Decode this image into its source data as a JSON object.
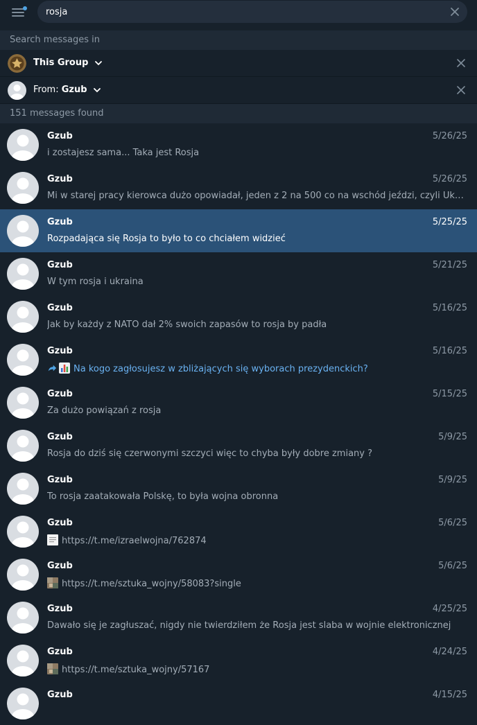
{
  "search": {
    "query": "rosja",
    "section_label": "Search messages in"
  },
  "filters": {
    "chat": {
      "label": "This Group"
    },
    "from": {
      "prefix": "From: ",
      "value": "Gzub"
    }
  },
  "results_count": "151 messages found",
  "results": [
    {
      "name": "Gzub",
      "date": "5/26/25",
      "text": "i zostajesz sama... Taka jest Rosja"
    },
    {
      "name": "Gzub",
      "date": "5/26/25",
      "text": "Mi w starej pracy kierowca dużo opowiadał, jeden z 2 na 500 co na wschód jeździ, czyli Ukraina i Rosja"
    },
    {
      "name": "Gzub",
      "date": "5/25/25",
      "text": "Rozpadająca się Rosja to było to co chciałem widzieć",
      "selected": true
    },
    {
      "name": "Gzub",
      "date": "5/21/25",
      "text": "W tym rosja i ukraina"
    },
    {
      "name": "Gzub",
      "date": "5/16/25",
      "text": "Jak by każdy z NATO dał 2% swoich zapasów to rosja by padła"
    },
    {
      "name": "Gzub",
      "date": "5/16/25",
      "text": "Na kogo zagłosujesz w zbliżających się wyborach prezydenckich?",
      "icon": "forward-poll-icon"
    },
    {
      "name": "Gzub",
      "date": "5/15/25",
      "text": "Za dużo powiązań z rosja"
    },
    {
      "name": "Gzub",
      "date": "5/9/25",
      "text": "Rosja do dziś się czerwonymi szczyci więc to chyba były dobre zmiany ?"
    },
    {
      "name": "Gzub",
      "date": "5/9/25",
      "text": "To rosja zaatakowała Polskę, to była wojna obronna"
    },
    {
      "name": "Gzub",
      "date": "5/6/25",
      "text": "https://t.me/izraelwojna/762874",
      "icon": "document-thumb-icon"
    },
    {
      "name": "Gzub",
      "date": "5/6/25",
      "text": "https://t.me/sztuka_wojny/58083?single",
      "icon": "photo-thumb-icon"
    },
    {
      "name": "Gzub",
      "date": "4/25/25",
      "text": "Dawało się je zagłuszać, nigdy nie twierdziłem że Rosja jest slaba w wojnie elektronicznej"
    },
    {
      "name": "Gzub",
      "date": "4/24/25",
      "text": "https://t.me/sztuka_wojny/57167",
      "icon": "photo-thumb-icon"
    },
    {
      "name": "Gzub",
      "date": "4/15/25",
      "text": ""
    }
  ],
  "colors": {
    "background": "#17212b",
    "selected": "#2b5278",
    "accent": "#6ab2f2",
    "muted": "#8e9aa6"
  }
}
